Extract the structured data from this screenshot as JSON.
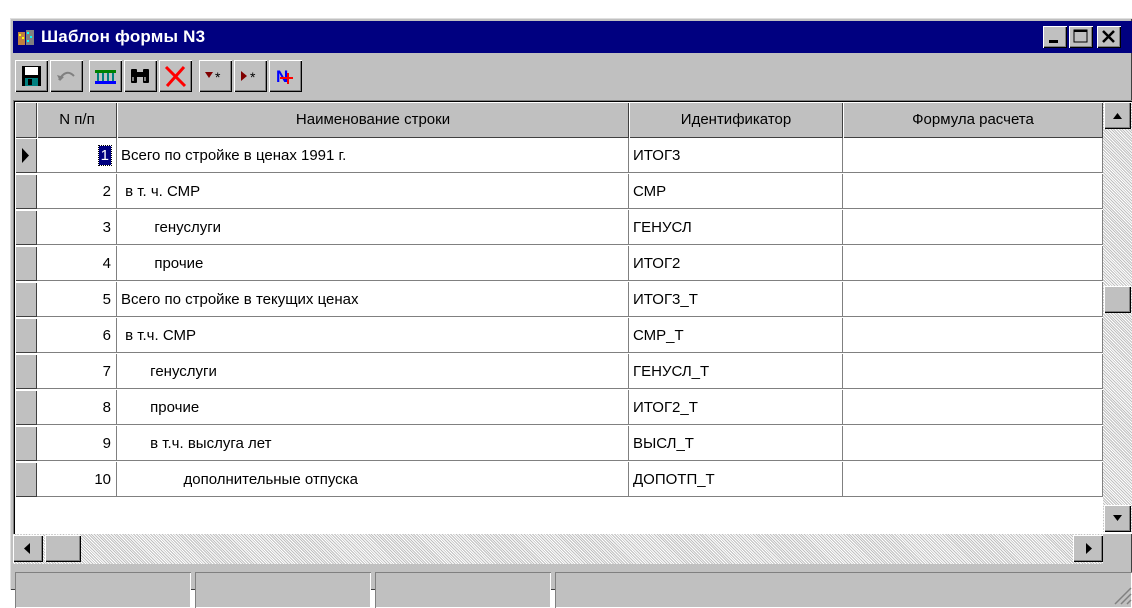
{
  "window": {
    "title": "Шаблон формы N3",
    "controls": {
      "minimize": "minimize",
      "maximize": "maximize",
      "close": "close"
    }
  },
  "toolbar": {
    "buttons": [
      {
        "name": "save",
        "icon": "floppy-disk-icon"
      },
      {
        "name": "undo",
        "icon": "undo-arrow-icon"
      },
      {
        "name": "columns",
        "icon": "columns-icon"
      },
      {
        "name": "find",
        "icon": "binoculars-icon"
      },
      {
        "name": "delete",
        "icon": "red-x-icon"
      },
      {
        "name": "insert-row-down",
        "icon": "insert-below-icon"
      },
      {
        "name": "insert-row",
        "icon": "insert-row-icon"
      },
      {
        "name": "formula",
        "icon": "formula-icon"
      }
    ]
  },
  "grid": {
    "columns": [
      "N п/п",
      "Наименование строки",
      "Идентификатор",
      "Формула расчета"
    ],
    "rows": [
      {
        "n": "1",
        "name": "Всего по стройке в ценах 1991 г.",
        "id": "ИТОГ3",
        "formula": ""
      },
      {
        "n": "2",
        "name": " в т. ч. СМР",
        "id": "СМР",
        "formula": ""
      },
      {
        "n": "3",
        "name": "        генуслуги",
        "id": "ГЕНУСЛ",
        "formula": ""
      },
      {
        "n": "4",
        "name": "        прочие",
        "id": "ИТОГ2",
        "formula": ""
      },
      {
        "n": "5",
        "name": "Всего по стройке в текущих ценах",
        "id": "ИТОГ3_Т",
        "formula": ""
      },
      {
        "n": "6",
        "name": " в т.ч. СМР",
        "id": "СМР_Т",
        "formula": ""
      },
      {
        "n": "7",
        "name": "       генуслуги",
        "id": "ГЕНУСЛ_Т",
        "formula": ""
      },
      {
        "n": "8",
        "name": "       прочие",
        "id": "ИТОГ2_Т",
        "formula": ""
      },
      {
        "n": "9",
        "name": "       в т.ч. выслуга лет",
        "id": "ВЫСЛ_Т",
        "formula": ""
      },
      {
        "n": "10",
        "name": "               дополнительные отпуска",
        "id": "ДОПОТП_Т",
        "formula": ""
      }
    ],
    "current_row": 1
  },
  "colors": {
    "titlebar": "#000080",
    "face": "#c0c0c0"
  }
}
